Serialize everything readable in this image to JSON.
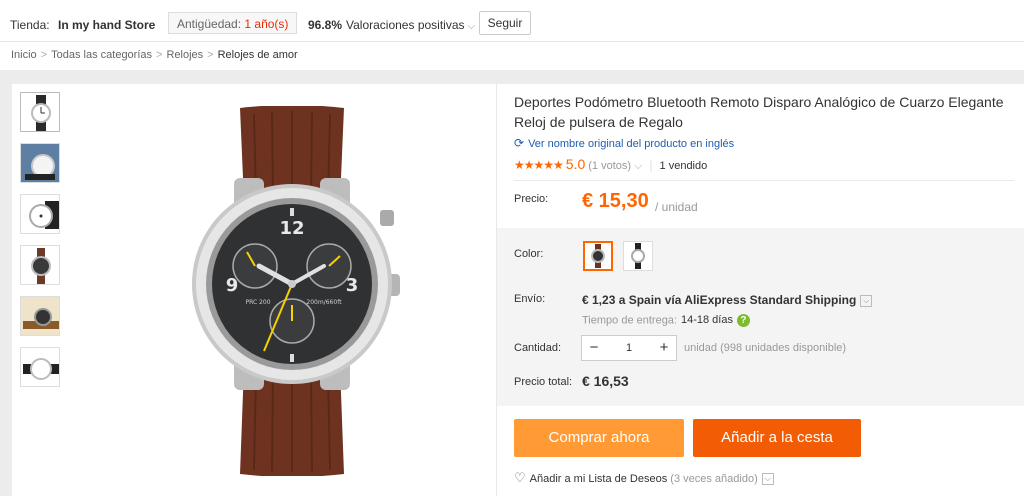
{
  "store": {
    "label": "Tienda:",
    "name": "In my hand Store",
    "age_label": "Antigüedad:",
    "age_value": "1 año(s)",
    "rating_percent": "96.8%",
    "rating_label": "Valoraciones positivas",
    "follow_label": "Seguir"
  },
  "breadcrumb": {
    "items": [
      "Inicio",
      "Todas las categorías",
      "Relojes",
      "Relojes de amor"
    ],
    "separator": ">"
  },
  "product": {
    "title": "Deportes Podómetro Bluetooth Remoto Disparo Analógico de Cuarzo Elegante Reloj de pulsera de Regalo",
    "translate_link": "Ver nombre original del producto en inglés",
    "stars": "★★★★★",
    "score": "5.0",
    "votes": "(1 votos)",
    "sold": "1 vendido"
  },
  "price": {
    "label": "Precio:",
    "value": "€ 15,30",
    "unit": "/ unidad"
  },
  "color": {
    "label": "Color:",
    "options": [
      "brown-strap",
      "black-strap"
    ],
    "selected_index": 0
  },
  "shipping": {
    "label": "Envío:",
    "value": "€ 1,23 a Spain vía AliExpress Standard Shipping",
    "delivery_label": "Tiempo de entrega:",
    "delivery_days": "14-18 días"
  },
  "quantity": {
    "label": "Cantidad:",
    "value": "1",
    "minus": "−",
    "plus": "+",
    "stock_info": "unidad (998 unidades disponible)"
  },
  "total": {
    "label": "Precio total:",
    "value": "€ 16,53"
  },
  "actions": {
    "buy_now": "Comprar ahora",
    "add_to_cart": "Añadir a la cesta"
  },
  "wishlist": {
    "label": "Añadir a mi Lista de Deseos",
    "count": "(3 veces añadido)"
  },
  "watch_face": {
    "numerals": [
      "12",
      "3",
      "9"
    ],
    "brand": "PRC 200",
    "depth": "200m/660ft"
  },
  "colors": {
    "accent": "#ff6600",
    "buy_button": "#ff9a34",
    "cart_button": "#f25c05",
    "link": "#1f5db0"
  }
}
